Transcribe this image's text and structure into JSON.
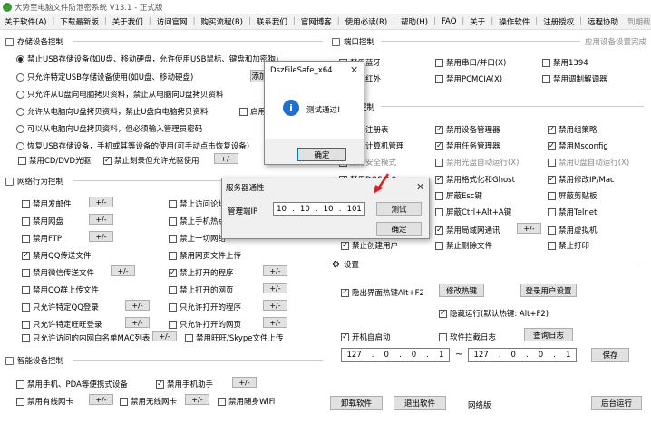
{
  "window": {
    "title": "大势至电脑文件防泄密系统 V13.1 - 正式版"
  },
  "menu": {
    "items": [
      "关于软件(A)",
      "下载最新版",
      "关于我们",
      "访问官网",
      "购买流程(B)",
      "联系我们",
      "官网博客",
      "使用必读(R)",
      "帮助(H)",
      "FAQ",
      "关于"
    ],
    "extra": [
      "操作软件",
      "注册授权",
      "远程协助"
    ],
    "right": "到期截止"
  },
  "storage": {
    "title": "存储设备控制",
    "options": [
      {
        "label": "禁止USB存储设备(如U盘、移动硬盘，允许使用USB鼠标、键盘和加密狗)"
      },
      {
        "label": "只允许特定USB存储设备使用(如U盘、移动硬盘)"
      },
      {
        "label": "只允许从U盘向电脑拷贝资料，禁止从电脑向U盘拷贝资料"
      },
      {
        "label": "允许从电脑向U盘拷贝资料，禁止U盘向电脑拷贝资料"
      },
      {
        "label": "可以从电脑向U盘拷贝资料，但必须输入管理员密码"
      },
      {
        "label": "恢复USB存储设备，手机或其等设备的使用(可手动点击恢复设备)"
      }
    ],
    "add_label": "添加",
    "enable_label": "启用",
    "cd_label": "禁用CD/DVD光驱",
    "fast_label": "禁止刻录但允许光驱使用",
    "pm": "+/-"
  },
  "network": {
    "title": "网络行为控制",
    "left": [
      "禁用发邮件",
      "禁用网盘",
      "禁用FTP",
      "禁用QQ传送文件",
      "禁用微信传送文件",
      "禁用QQ群上传文件",
      "只允许特定QQ登录",
      "只允许特定旺旺登录",
      "只允许访问的内网白名单MAC列表"
    ],
    "right": [
      "禁止访问论坛",
      "禁止手机热点",
      "禁止一切网络",
      "禁用网页文件上传",
      "禁止打开的程序",
      "禁止打开的网页",
      "只允许打开的程序",
      "只允许打开的网页",
      "禁用旺旺/Skype文件上传"
    ],
    "pm": "+/-"
  },
  "smart": {
    "title": "智能设备控制",
    "items": [
      "禁用手机、PDA等便携式设备",
      "禁用手机助手",
      "禁用有线网卡",
      "禁用无线网卡",
      "禁用随身WiFi"
    ],
    "pm": "+/-"
  },
  "port": {
    "title": "端口控制",
    "right_label": "应用设备设置完成",
    "items": [
      "禁用蓝牙",
      "禁用串口/并口(X)",
      "禁用1394",
      "禁用红外",
      "禁用PCMCIA(X)",
      "禁用调制解调器"
    ]
  },
  "system": {
    "title": "系统控制",
    "items": [
      "禁用注册表",
      "禁用设备管理器",
      "禁用组策略",
      "禁用计算机管理",
      "禁用任务管理器",
      "禁用Msconfig",
      "禁用安全模式",
      "禁用光盘自动运行(X)",
      "禁用U盘自动运行(X)",
      "禁用DOS命令",
      "禁用格式化和Ghost",
      "禁用修改IP/Mac",
      "",
      "屏蔽Esc键",
      "屏蔽剪贴板",
      "",
      "屏蔽Ctrl+Alt+A键",
      "禁用Telnet",
      "",
      "禁用局域网通讯",
      "禁用虚拟机",
      "禁止创建用户",
      "禁止删除文件",
      "禁止打印"
    ],
    "pm": "+/-"
  },
  "settings": {
    "title": "设置",
    "hotkey_label": "隐出界面热键Alt+F2",
    "modify_hotkey": "修改热键",
    "login_settings": "登录用户设置",
    "hide_label": "隐藏运行(默认热键: Alt+F2)",
    "autostart_label": "开机自启动",
    "log_label": "软件拦截日志",
    "query_log": "查询日志",
    "ip_start": [
      "127",
      "0",
      "0",
      "1"
    ],
    "ip_end": [
      "127",
      "0",
      "0",
      "1"
    ],
    "tilde": "~",
    "save": "保存"
  },
  "bottom": {
    "uninstall": "卸载软件",
    "exit": "退出软件",
    "net_label": "网络版",
    "background": "后台运行"
  },
  "dialog1": {
    "title": "DszFileSafe_x64",
    "message": "测试通过!",
    "ok": "确定",
    "close": "✕"
  },
  "dialog2": {
    "title": "服务器通性",
    "ip_label": "管理端IP",
    "ip": [
      "10",
      "10",
      "10",
      "101"
    ],
    "test": "测试",
    "ok": "确定",
    "close": "✕"
  }
}
